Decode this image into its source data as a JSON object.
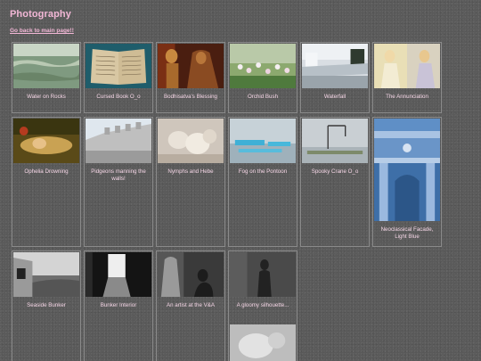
{
  "header": {
    "title": "Photography",
    "back_link": "Go back to main page!!"
  },
  "gallery": {
    "items": [
      {
        "caption": "Water on Rocks",
        "icon": "water-rocks-photo"
      },
      {
        "caption": "Cursed Book O_o",
        "icon": "book-photo"
      },
      {
        "caption": "Bodhisatva's Blessing",
        "icon": "statue-photo"
      },
      {
        "caption": "Orchid Bush",
        "icon": "orchid-photo"
      },
      {
        "caption": "Waterfall",
        "icon": "waterfall-photo"
      },
      {
        "caption": "The Annunciation",
        "icon": "painting-photo"
      },
      {
        "caption": "Ophelia Drowning",
        "icon": "ophelia-photo"
      },
      {
        "caption": "Pidgeons manning the walls!",
        "icon": "castle-wall-photo"
      },
      {
        "caption": "Nymphs and Hebe",
        "icon": "sculpture-photo"
      },
      {
        "caption": "Fog on the Pontoon",
        "icon": "pontoon-photo"
      },
      {
        "caption": "Spooky Crane O_o",
        "icon": "crane-photo"
      },
      {
        "caption": "Neoclassical Facade, Light Blue",
        "icon": "facade-photo"
      },
      {
        "caption": "Seaside Bunker",
        "icon": "bunker-photo"
      },
      {
        "caption": "Bunker Interior",
        "icon": "bunker-interior-photo"
      },
      {
        "caption": "An artist at the V&A",
        "icon": "artist-photo"
      },
      {
        "caption": "A gloomy silhouette...",
        "icon": "silhouette-photo"
      },
      {
        "caption": "",
        "icon": "sculpture-relief-photo"
      }
    ]
  },
  "colors": {
    "title": "#f2b7d6",
    "caption": "#f5d6e6",
    "cell_border": "#8a8a8a"
  }
}
